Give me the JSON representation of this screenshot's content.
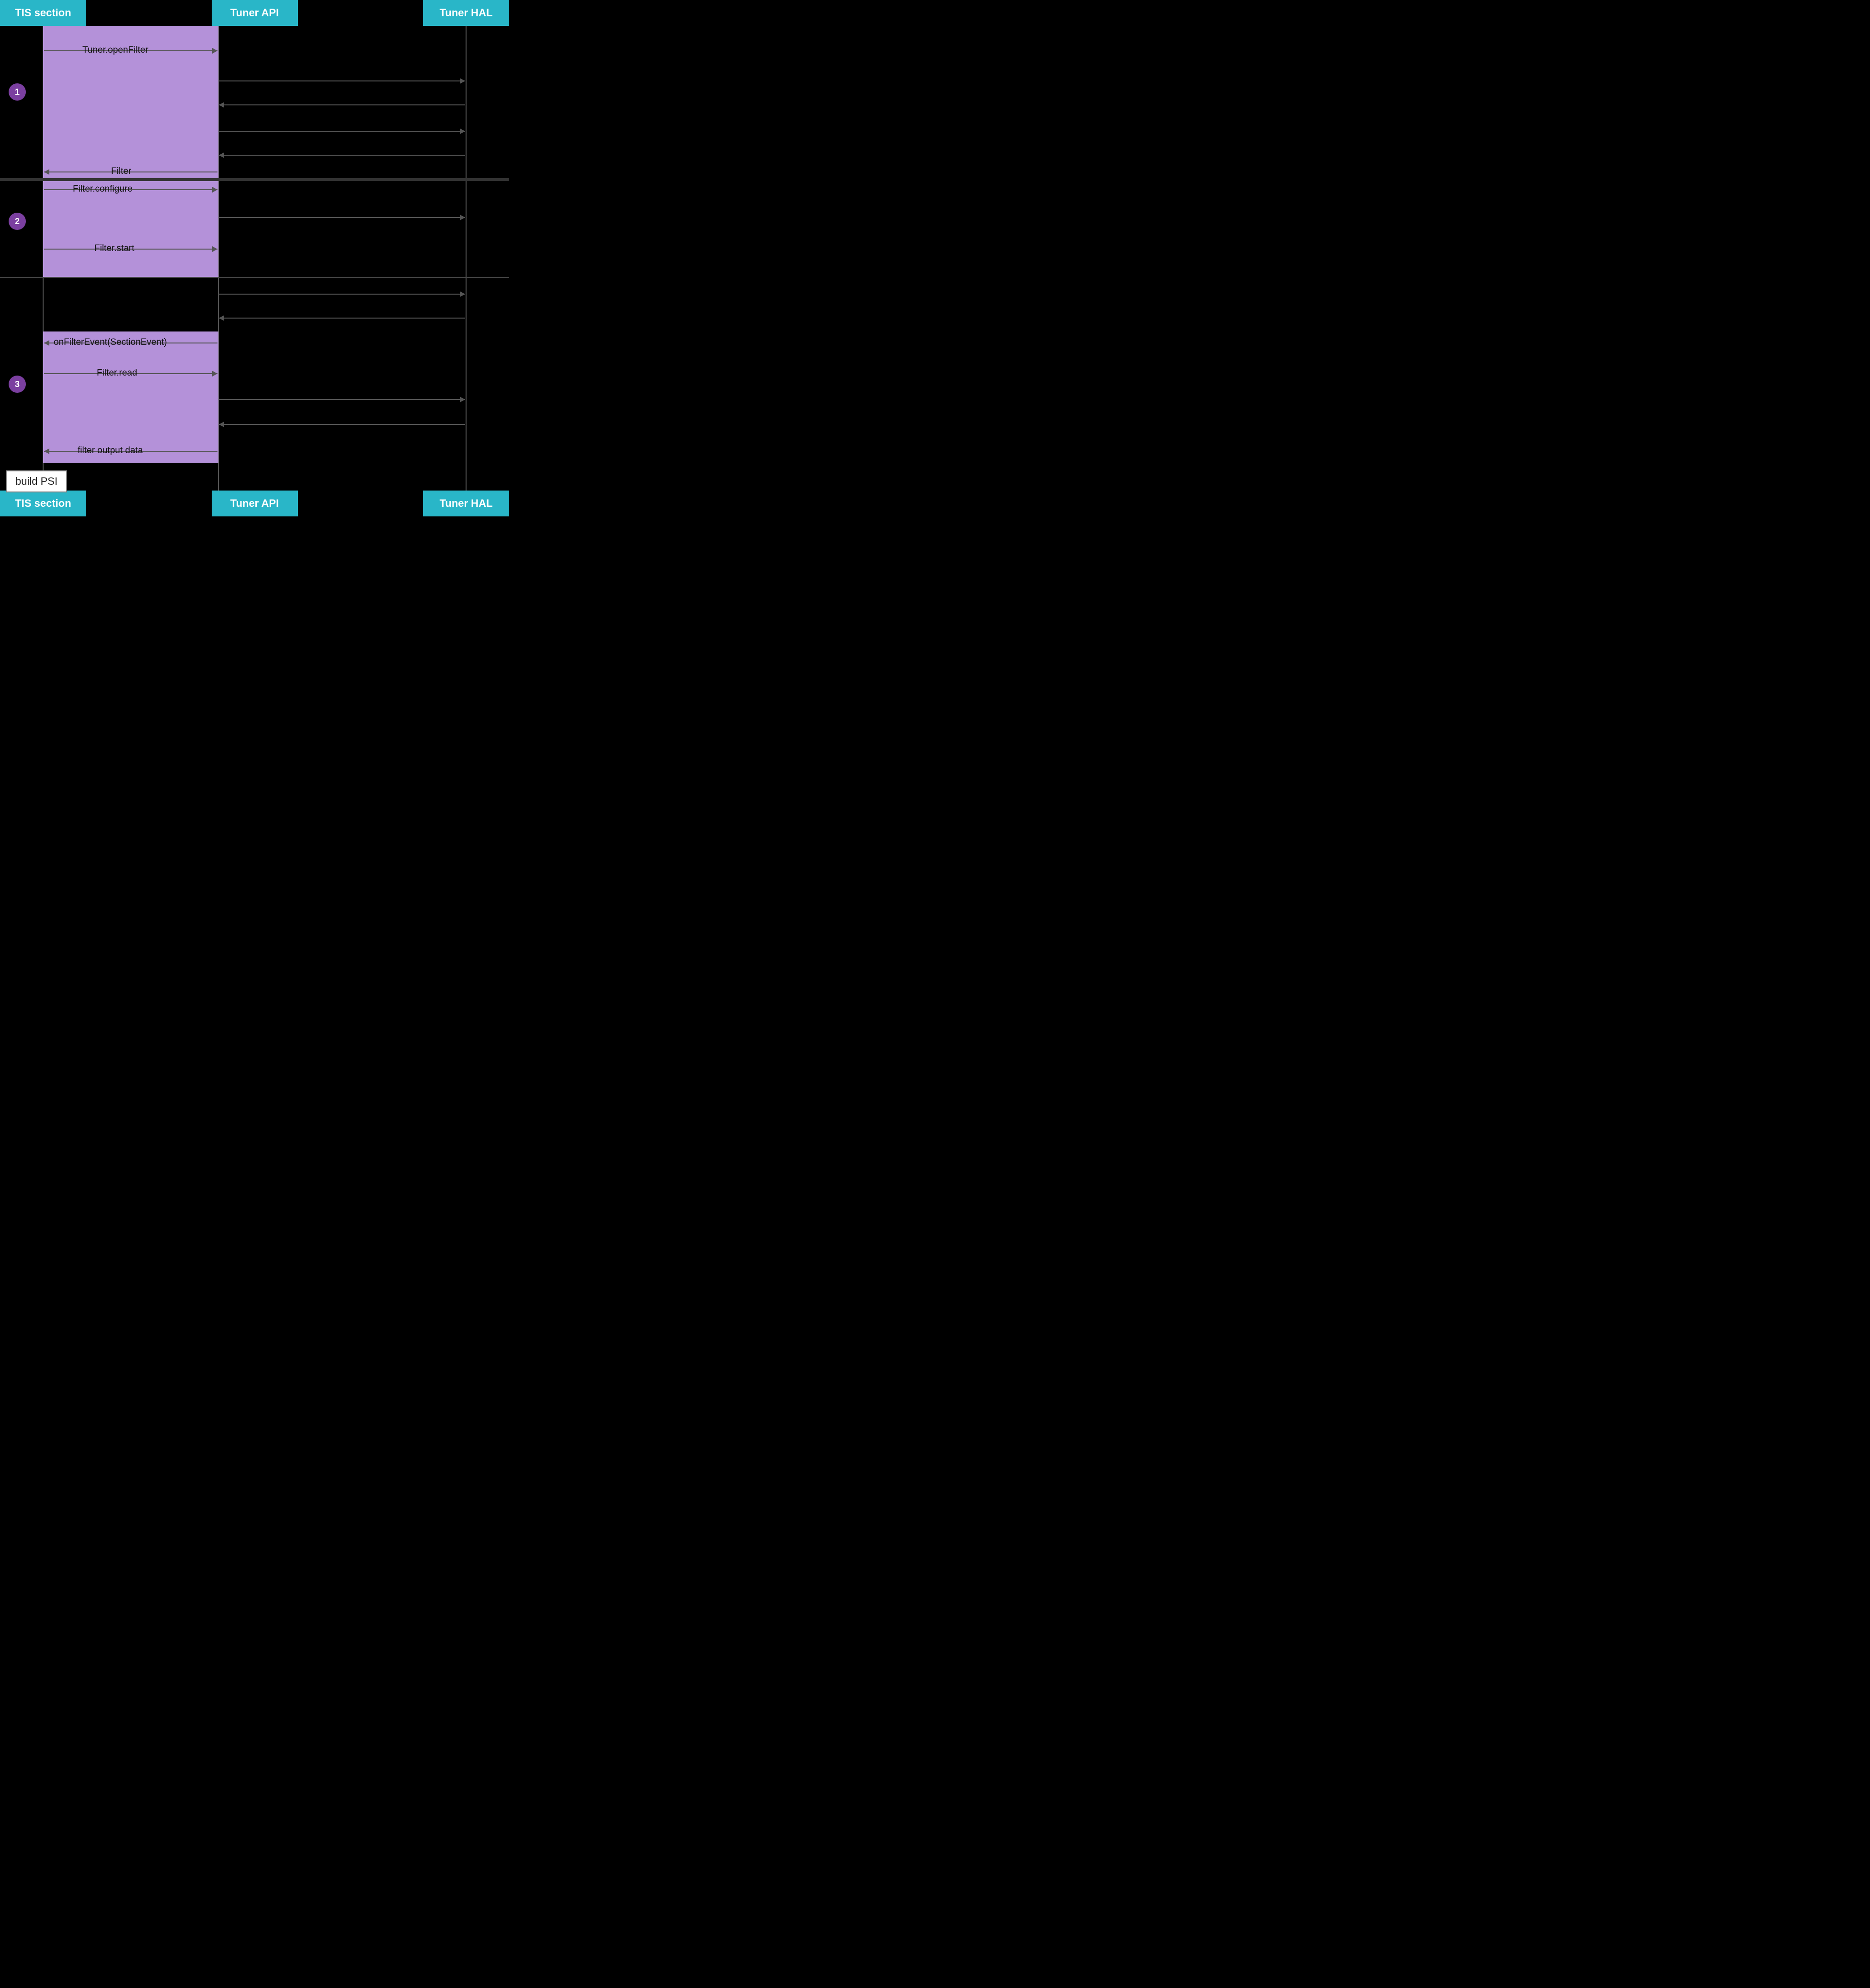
{
  "header": {
    "tis_label": "TIS section",
    "tuner_api_label": "Tuner API",
    "tuner_hal_label": "Tuner HAL"
  },
  "footer": {
    "tis_label": "TIS section",
    "tuner_api_label": "Tuner API",
    "tuner_hal_label": "Tuner HAL"
  },
  "steps": [
    {
      "number": "1"
    },
    {
      "number": "2"
    },
    {
      "number": "3"
    }
  ],
  "arrows": [
    {
      "id": "tuner-open-filter",
      "label": "Tuner.openFilter",
      "direction": "right"
    },
    {
      "id": "filter-return",
      "label": "Filter",
      "direction": "left"
    },
    {
      "id": "filter-configure",
      "label": "Filter.configure",
      "direction": "right"
    },
    {
      "id": "filter-start",
      "label": "Filter.start",
      "direction": "right"
    },
    {
      "id": "on-filter-event",
      "label": "onFilterEvent(SectionEvent)",
      "direction": "left"
    },
    {
      "id": "filter-read",
      "label": "Filter.read",
      "direction": "right"
    },
    {
      "id": "filter-output-data",
      "label": "filter output data",
      "direction": "left"
    }
  ],
  "build_psi": {
    "label": "build PSI"
  },
  "colors": {
    "header_bg": "#29b6c8",
    "section_bg": "#d4aaff",
    "step_circle_bg": "#7b3fa0",
    "arrow_line": "#555555",
    "build_psi_bg": "#ffffff"
  }
}
